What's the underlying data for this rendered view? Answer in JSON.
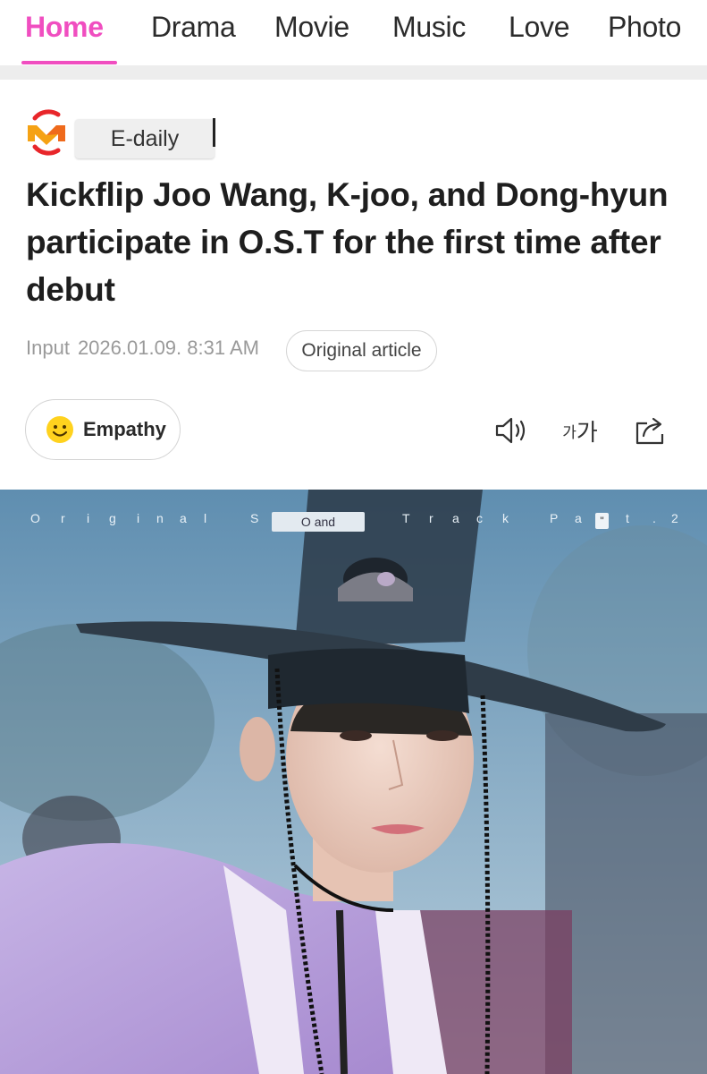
{
  "nav": {
    "tabs": [
      {
        "label": "Home",
        "active": true
      },
      {
        "label": "Drama",
        "active": false
      },
      {
        "label": "Movie",
        "active": false
      },
      {
        "label": "Music",
        "active": false
      },
      {
        "label": "Love",
        "active": false
      },
      {
        "label": "Photo",
        "active": false
      }
    ],
    "accent_color": "#f04ec0"
  },
  "article": {
    "source": "E-daily",
    "source_logo_icon": "media-logo-icon",
    "headline": "Kickflip Joo Wang, K-joo, and Dong-hyun participate in O.S.T for the first time after debut",
    "input_label": "Input",
    "timestamp": "2026.01.09. 8:31 AM",
    "original_article_label": "Original article"
  },
  "actions": {
    "empathy_label": "Empathy",
    "empathy_icon": "smiley-icon",
    "listen_icon": "speaker-icon",
    "font_size_text": {
      "small": "가",
      "large": "가"
    },
    "share_icon": "share-icon"
  },
  "hero_image": {
    "overlay_letters": [
      "O",
      "r",
      "i",
      "g",
      "i",
      "n",
      "a",
      "l",
      "S",
      "T",
      "r",
      "a",
      "c",
      "k",
      "P",
      "a",
      "t",
      ".",
      "2"
    ],
    "overlay_box_text": "O and",
    "overlay_mark_text": "\""
  }
}
